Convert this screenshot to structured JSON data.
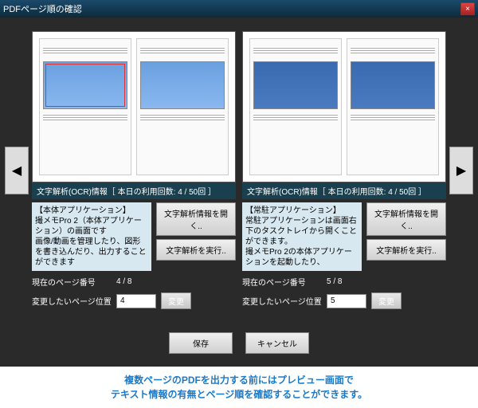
{
  "title": "PDFページ順の確認",
  "close": "×",
  "arrow_left": "◀",
  "arrow_right": "▶",
  "panels": [
    {
      "ocr_info": "文字解析(OCR)情報［ 本日の利用回数: 4 / 50回 ］",
      "app_info": "【本体アプリケーション】\n撮メモPro 2（本体アプリケーション）の画面です\n画像/動画を管理したり、図形を書き込んだり、出力することができます",
      "btn_open": "文字解析情報を開く..",
      "btn_run": "文字解析を実行..",
      "page_label": "現在のページ番号",
      "page_value": "4 / 8",
      "pos_label": "変更したいページ位置",
      "pos_value": "4",
      "change": "変更"
    },
    {
      "ocr_info": "文字解析(OCR)情報［ 本日の利用回数: 4 / 50回 ］",
      "app_info": "【常駐アプリケーション】\n常駐アプリケーションは画面右下のタスクトレイから開くことができます。\n撮メモPro 2の本体アプリケーションを起動したり、",
      "btn_open": "文字解析情報を開く..",
      "btn_run": "文字解析を実行..",
      "page_label": "現在のページ番号",
      "page_value": "5 / 8",
      "pos_label": "変更したいページ位置",
      "pos_value": "5",
      "change": "変更"
    }
  ],
  "save": "保存",
  "cancel": "キャンセル",
  "caption": "複数ページのPDFを出力する前にはプレビュー画面で\nテキスト情報の有無とページ順を確認することができます。"
}
